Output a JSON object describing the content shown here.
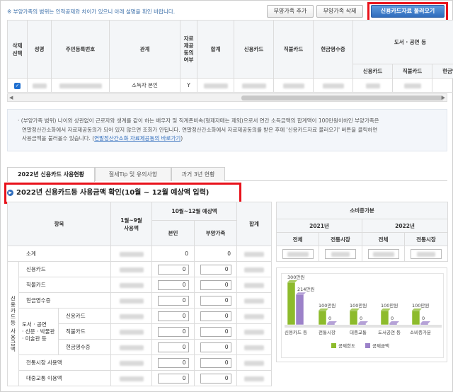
{
  "header": {
    "notice": "※ 부양가족의 범위는 인적공제와 차이가 있으니 아래 설명을 확인 바랍니다.",
    "add_dependent": "부양가족 추가",
    "delete_dependent": "부양가족 삭제",
    "load_card": "신용카드자료 불러오기"
  },
  "top_table": {
    "col_delete": "삭제\n선택",
    "col_name": "성명",
    "col_rrn": "주민등록번호",
    "col_relation": "관계",
    "col_provided": "자료\n제공\n동의\n여부",
    "col_total": "합계",
    "col_credit": "신용카드",
    "col_debit": "직불카드",
    "col_cash": "현금영수증",
    "col_culture": "도서 · 공연 등",
    "sub_credit": "신용카드",
    "sub_debit": "직불카드",
    "sub_cash": "현금영",
    "row_relation": "소득자 본인",
    "row_provided": "Y",
    "cut_header": "전"
  },
  "infobox": {
    "line1": "· (부양가족 범위) 나이와 상관없이 근로자와 생계를 같이 하는 배우자 및 직계존비속(형제자매는 제외)으로서 연간 소득금액의 합계액이 100만원이하인 부양가족은",
    "line2": "연말정산간소화에서 자료제공동의가 되어 있지 않으면 조회가 안됩니다. 연말정산간소화에서 자료제공동의를 받은 후에 '신용카드자료 불러오기' 버튼을 클릭하면",
    "line3": "사용금액을 불러올수 있습니다. (",
    "link": "연말정산간소화 자료제공동의 바로가기",
    "line3_end": ")"
  },
  "tabs": [
    "2022년 신용카드 사용현황",
    "절세Tip 및 유의사항",
    "과거 3년 현황"
  ],
  "section_title": "2022년 신용카드등 사용금액 확인(10월 ~ 12월 예상액 입력)",
  "main_table": {
    "col_item": "항목",
    "col_used": "1월~9월\n사용액",
    "col_expected": "10월~12월 예상액",
    "col_self": "본인",
    "col_dependent": "부양가족",
    "col_total": "합계",
    "rows": [
      {
        "label": "소계",
        "self": "0",
        "dep": "0"
      },
      {
        "label": "신용카드",
        "self": "0",
        "dep": "0"
      },
      {
        "label": "직불카드",
        "self": "0",
        "dep": "0"
      },
      {
        "label": "현금영수증",
        "self": "0",
        "dep": "0"
      },
      {
        "label": "신용카드",
        "self": "0",
        "dep": "0"
      },
      {
        "label": "직불카드",
        "self": "0",
        "dep": "0"
      },
      {
        "label": "현금영수증",
        "self": "0",
        "dep": "0"
      },
      {
        "label": "전통시장 사용액",
        "self": "0",
        "dep": "0"
      },
      {
        "label": "대중교통 이용액",
        "self": "0",
        "dep": "0"
      }
    ],
    "group_label": "신용카드등 사용금액",
    "culture_label": "도서 · 공연\n· 신문 · 박물관\n· 미술관 등"
  },
  "right_table": {
    "title": "소비증가분",
    "y2021": "2021년",
    "y2022": "2022년",
    "total": "전체",
    "market": "전통시장"
  },
  "chart_data": {
    "type": "bar",
    "categories": [
      "신용카드 등",
      "전통시장",
      "대중교통",
      "도서공연 등",
      "소비증가분"
    ],
    "series": [
      {
        "name": "공제한도",
        "values": [
          300,
          100,
          100,
          100,
          100
        ]
      },
      {
        "name": "공제금액",
        "values": [
          214,
          0,
          0,
          0,
          0
        ]
      }
    ],
    "value_labels": [
      [
        "300만원",
        "100만원",
        "100만원",
        "100만원",
        "100만원"
      ],
      [
        "214만원",
        "0",
        "0",
        "0",
        "0"
      ]
    ],
    "ylim": [
      0,
      300
    ],
    "colors": {
      "limit": "#8dbb2c",
      "amount": "#9c82c9"
    },
    "legend": "bottom"
  }
}
